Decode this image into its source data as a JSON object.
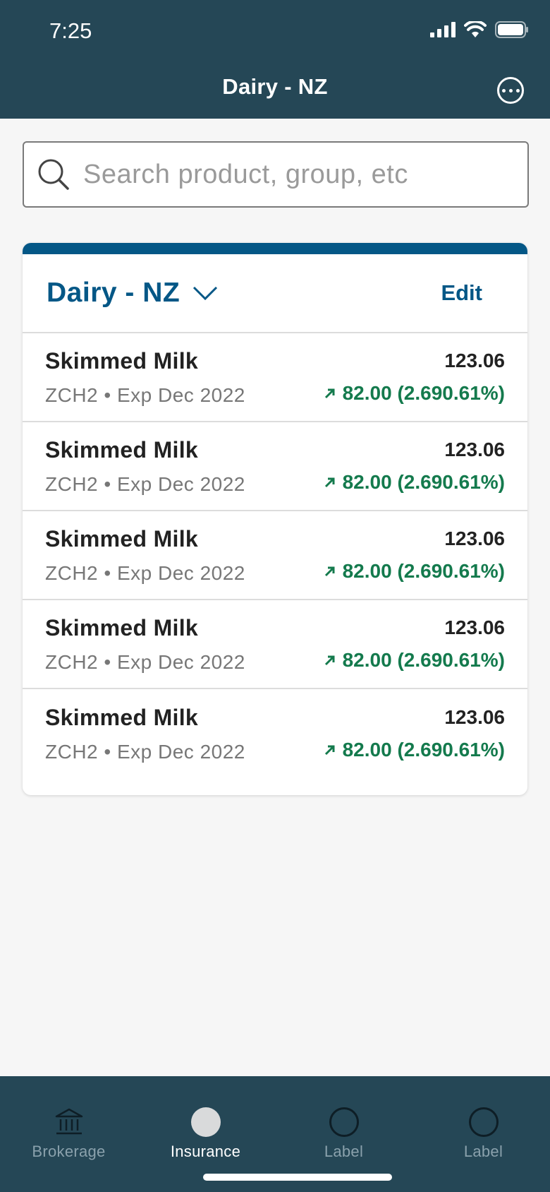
{
  "status_bar": {
    "time": "7:25"
  },
  "header": {
    "title": "Dairy - NZ"
  },
  "search": {
    "placeholder": "Search product, group, etc"
  },
  "group": {
    "title": "Dairy - NZ",
    "edit_label": "Edit"
  },
  "rows": [
    {
      "product": "Skimmed Milk",
      "meta": "ZCH2 • Exp Dec 2022",
      "price": "123.06",
      "change": "82.00 (2.690.61%)"
    },
    {
      "product": "Skimmed Milk",
      "meta": "ZCH2 • Exp Dec 2022",
      "price": "123.06",
      "change": "82.00 (2.690.61%)"
    },
    {
      "product": "Skimmed Milk",
      "meta": "ZCH2 • Exp Dec 2022",
      "price": "123.06",
      "change": "82.00 (2.690.61%)"
    },
    {
      "product": "Skimmed Milk",
      "meta": "ZCH2 • Exp Dec 2022",
      "price": "123.06",
      "change": "82.00 (2.690.61%)"
    },
    {
      "product": "Skimmed Milk",
      "meta": "ZCH2 • Exp Dec 2022",
      "price": "123.06",
      "change": "82.00 (2.690.61%)"
    }
  ],
  "tabs": [
    {
      "label": "Brokerage",
      "icon": "bank-icon"
    },
    {
      "label": "Insurance",
      "icon": "filled-circle-icon",
      "active": true
    },
    {
      "label": "Label",
      "icon": "circle-icon"
    },
    {
      "label": "Label",
      "icon": "circle-icon"
    }
  ],
  "colors": {
    "header_bg": "#254756",
    "accent": "#045786",
    "positive": "#147a4d"
  }
}
